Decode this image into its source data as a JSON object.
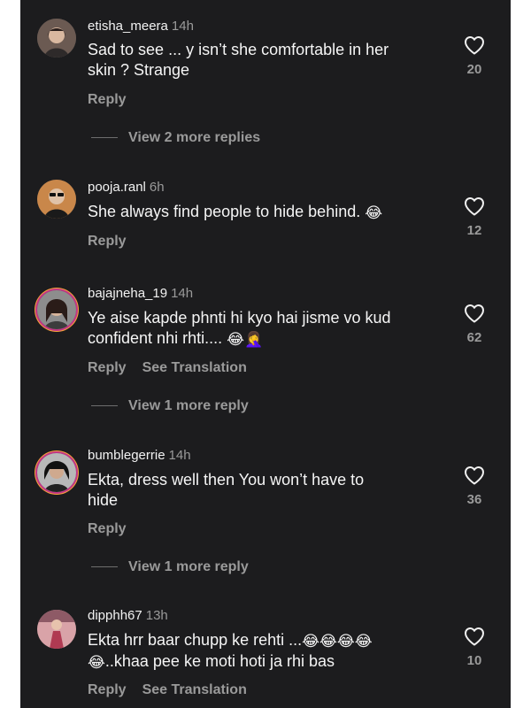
{
  "comments": [
    {
      "username": "etisha_meera",
      "time": "14h",
      "text_line1": "Sad to see ... y isn’t she comfortable in her",
      "text_line2": "skin ? Strange",
      "reply_label": "Reply",
      "view_more": "View 2 more replies",
      "likes": "20"
    },
    {
      "username": "pooja.ranl",
      "time": "6h",
      "text_line1": "She always find people to hide behind.",
      "emoji": "😂",
      "reply_label": "Reply",
      "likes": "12"
    },
    {
      "username": "bajajneha_19",
      "time": "14h",
      "text_line1": "Ye aise kapde phnti hi kyo hai jisme vo kud",
      "text_line2": "confident nhi rhti....",
      "emoji_a": "😂",
      "emoji_b": "🤦‍♀️",
      "reply_label": "Reply",
      "translation_label": "See Translation",
      "view_more": "View 1 more reply",
      "likes": "62"
    },
    {
      "username": "bumblegerrie",
      "time": "14h",
      "text_line1": "Ekta, dress well then You won’t have to",
      "text_line2": "hide",
      "reply_label": "Reply",
      "view_more": "View 1 more reply",
      "likes": "36"
    },
    {
      "username": "dipphh67",
      "time": "13h",
      "text_line1": "Ekta hrr baar chupp ke rehti ...",
      "emojis_line1": "😂😂😂😂",
      "emoji_line2": "😂",
      "text_line2": "..khaa pee ke moti hoti ja rhi bas",
      "reply_label": "Reply",
      "translation_label": "See Translation",
      "likes": "10"
    }
  ],
  "colors": {
    "background": "#1c1c1e",
    "primary_text": "#f5f5f5",
    "secondary_text": "#9a9a9a",
    "story_ring": "#c13584"
  },
  "icons": {
    "like": "heart-outline-icon"
  }
}
